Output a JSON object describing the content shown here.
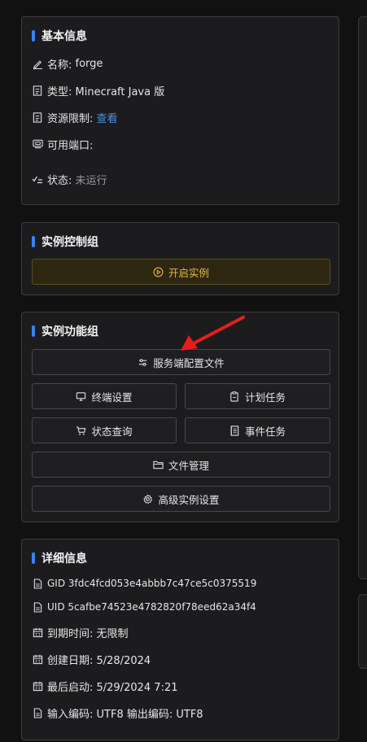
{
  "basic_info": {
    "title": "基本信息",
    "name_label": "名称:",
    "name_value": "forge",
    "type_label": "类型:",
    "type_value": "Minecraft Java 版",
    "resource_label": "资源限制:",
    "resource_link": "查看",
    "port_label": "可用端口:",
    "status_label": "状态:",
    "status_value": "未运行"
  },
  "control": {
    "title": "实例控制组",
    "start_label": "开启实例"
  },
  "functions": {
    "title": "实例功能组",
    "server_config": "服务端配置文件",
    "terminal": "终端设置",
    "schedule": "计划任务",
    "status_query": "状态查询",
    "event_task": "事件任务",
    "file_manager": "文件管理",
    "advanced": "高级实例设置"
  },
  "details": {
    "title": "详细信息",
    "gid": "GID 3fdc4fcd053e4abbb7c47ce5c0375519",
    "uid": "UID 5cafbe74523e4782820f78eed62a34f4",
    "expire": "到期时间: 无限制",
    "created": "创建日期: 5/28/2024",
    "last_start": "最后启动: 5/29/2024 7:21",
    "encoding": "输入编码: UTF8 输出编码: UTF8"
  },
  "colors": {
    "accent": "#3b82f6",
    "link": "#4f8fe8",
    "warning": "#e3b53f",
    "annotation_arrow": "#e81c1c"
  },
  "icons": {
    "name": "pencil-icon",
    "type": "document-icon",
    "resource": "document-icon",
    "port": "network-card-icon",
    "status": "check-list-icon",
    "start": "play-circle-icon",
    "server_config": "sliders-icon",
    "terminal": "monitor-icon",
    "schedule": "clipboard-icon",
    "status_query": "cart-icon",
    "event_task": "notebook-icon",
    "file_manager": "folder-icon",
    "advanced": "gear-icon",
    "gid": "file-icon",
    "uid": "file-icon",
    "calendar": "calendar-icon"
  }
}
